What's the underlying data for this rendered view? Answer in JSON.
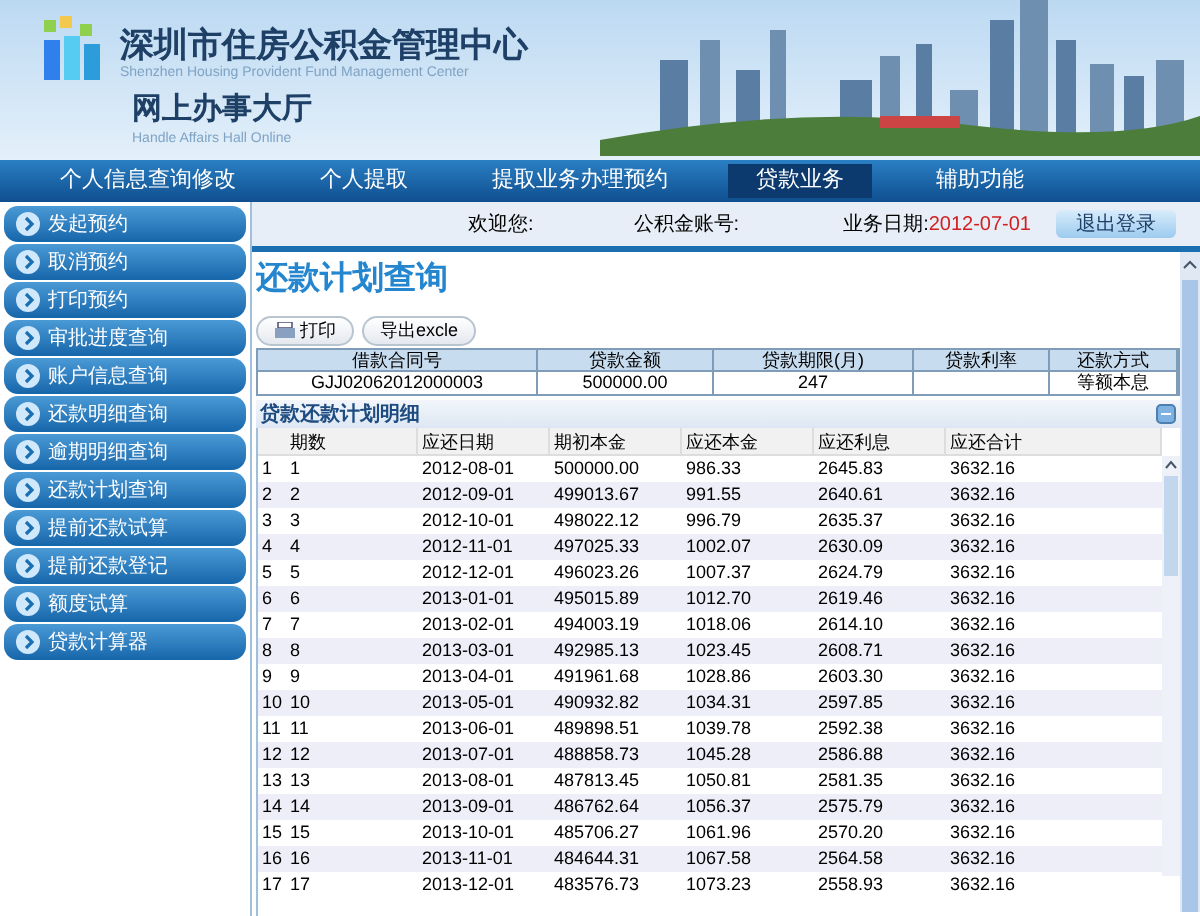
{
  "header": {
    "title": "深圳市住房公积金管理中心",
    "subtitle_en": "Shenzhen Housing Provident Fund Management Center",
    "hall": "网上办事大厅",
    "hall_en": "Handle Affairs Hall Online"
  },
  "nav": [
    {
      "label": "个人信息查询修改",
      "selected": false
    },
    {
      "label": "个人提取",
      "selected": false
    },
    {
      "label": "提取业务办理预约",
      "selected": false
    },
    {
      "label": "贷款业务",
      "selected": true
    },
    {
      "label": "辅助功能",
      "selected": false
    }
  ],
  "sidebar": {
    "items": [
      {
        "label": "发起预约"
      },
      {
        "label": "取消预约"
      },
      {
        "label": "打印预约"
      },
      {
        "label": "审批进度查询"
      },
      {
        "label": "账户信息查询"
      },
      {
        "label": "还款明细查询"
      },
      {
        "label": "逾期明细查询"
      },
      {
        "label": "还款计划查询"
      },
      {
        "label": "提前还款试算"
      },
      {
        "label": "提前还款登记"
      },
      {
        "label": "额度试算"
      },
      {
        "label": "贷款计算器"
      }
    ]
  },
  "info_bar": {
    "welcome_label": "欢迎您:",
    "account_label": "公积金账号:",
    "date_label": "业务日期:",
    "date": "2012-07-01",
    "logout": "退出登录"
  },
  "page_title": "还款计划查询",
  "toolbar": [
    {
      "label": "打印",
      "kind": "print"
    },
    {
      "label": "导出excle",
      "kind": "plain"
    }
  ],
  "summary": [
    {
      "header": "借款合同号",
      "value": "GJJ02062012000003"
    },
    {
      "header": "贷款金额",
      "value": "500000.00"
    },
    {
      "header": "贷款期限(月)",
      "value": "247"
    },
    {
      "header": "贷款利率"
    },
    {
      "header": "还款方式",
      "value": "等额本息"
    }
  ],
  "schedule": {
    "title": "贷款还款计划明细",
    "columns": [
      "期数",
      "应还日期",
      "期初本金",
      "应还本金",
      "应还利息",
      "应还合计"
    ],
    "rows": [
      {
        "number": "1",
        "cells": [
          "1",
          "2012-08-01",
          "500000.00",
          "986.33",
          "2645.83",
          "3632.16"
        ]
      },
      {
        "number": "2",
        "cells": [
          "2",
          "2012-09-01",
          "499013.67",
          "991.55",
          "2640.61",
          "3632.16"
        ]
      },
      {
        "number": "3",
        "cells": [
          "3",
          "2012-10-01",
          "498022.12",
          "996.79",
          "2635.37",
          "3632.16"
        ]
      },
      {
        "number": "4",
        "cells": [
          "4",
          "2012-11-01",
          "497025.33",
          "1002.07",
          "2630.09",
          "3632.16"
        ]
      },
      {
        "number": "5",
        "cells": [
          "5",
          "2012-12-01",
          "496023.26",
          "1007.37",
          "2624.79",
          "3632.16"
        ]
      },
      {
        "number": "6",
        "cells": [
          "6",
          "2013-01-01",
          "495015.89",
          "1012.70",
          "2619.46",
          "3632.16"
        ]
      },
      {
        "number": "7",
        "cells": [
          "7",
          "2013-02-01",
          "494003.19",
          "1018.06",
          "2614.10",
          "3632.16"
        ]
      },
      {
        "number": "8",
        "cells": [
          "8",
          "2013-03-01",
          "492985.13",
          "1023.45",
          "2608.71",
          "3632.16"
        ]
      },
      {
        "number": "9",
        "cells": [
          "9",
          "2013-04-01",
          "491961.68",
          "1028.86",
          "2603.30",
          "3632.16"
        ]
      },
      {
        "number": "10",
        "cells": [
          "10",
          "2013-05-01",
          "490932.82",
          "1034.31",
          "2597.85",
          "3632.16"
        ]
      },
      {
        "number": "11",
        "cells": [
          "11",
          "2013-06-01",
          "489898.51",
          "1039.78",
          "2592.38",
          "3632.16"
        ]
      },
      {
        "number": "12",
        "cells": [
          "12",
          "2013-07-01",
          "488858.73",
          "1045.28",
          "2586.88",
          "3632.16"
        ]
      },
      {
        "number": "13",
        "cells": [
          "13",
          "2013-08-01",
          "487813.45",
          "1050.81",
          "2581.35",
          "3632.16"
        ]
      },
      {
        "number": "14",
        "cells": [
          "14",
          "2013-09-01",
          "486762.64",
          "1056.37",
          "2575.79",
          "3632.16"
        ]
      },
      {
        "number": "15",
        "cells": [
          "15",
          "2013-10-01",
          "485706.27",
          "1061.96",
          "2570.20",
          "3632.16"
        ]
      },
      {
        "number": "16",
        "cells": [
          "16",
          "2013-11-01",
          "484644.31",
          "1067.58",
          "2564.58",
          "3632.16"
        ]
      },
      {
        "number": "17",
        "cells": [
          "17",
          "2013-12-01",
          "483576.73",
          "1073.23",
          "2558.93",
          "3632.16"
        ]
      }
    ]
  }
}
